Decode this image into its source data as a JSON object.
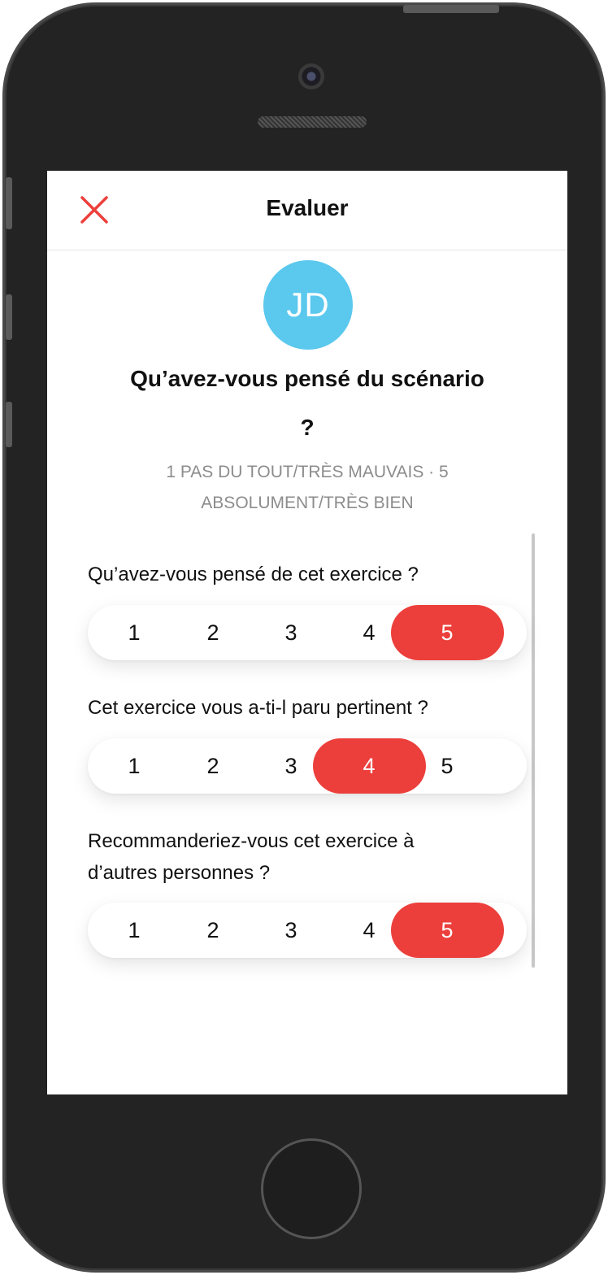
{
  "header": {
    "title": "Evaluer",
    "close_icon": "close-icon"
  },
  "avatar": {
    "initials": "JD",
    "color": "#5bc8ee"
  },
  "main": {
    "title_line1": "Qu’avez-vous pensé du scénario",
    "title_line2": "?",
    "scale_hint_line1": "1 PAS DU TOUT/TRÈS MAUVAIS · 5",
    "scale_hint_line2": "ABSOLUMENT/TRÈS BIEN"
  },
  "questions": [
    {
      "label_line1": "Qu’avez-vous pensé de cet exercice ?",
      "label_line2": "",
      "options": [
        "1",
        "2",
        "3",
        "4",
        "5"
      ],
      "selected": "5"
    },
    {
      "label_line1": "Cet exercice vous a-ti-l paru pertinent ?",
      "label_line2": "",
      "options": [
        "1",
        "2",
        "3",
        "4",
        "5"
      ],
      "selected": "4"
    },
    {
      "label_line1": "Recommanderiez-vous cet exercice à",
      "label_line2": "d’autres personnes ?",
      "options": [
        "1",
        "2",
        "3",
        "4",
        "5"
      ],
      "selected": "5"
    }
  ],
  "colors": {
    "accent": "#ec3f3b",
    "avatar": "#5bc8ee",
    "hint_text": "#8c8c8c"
  }
}
